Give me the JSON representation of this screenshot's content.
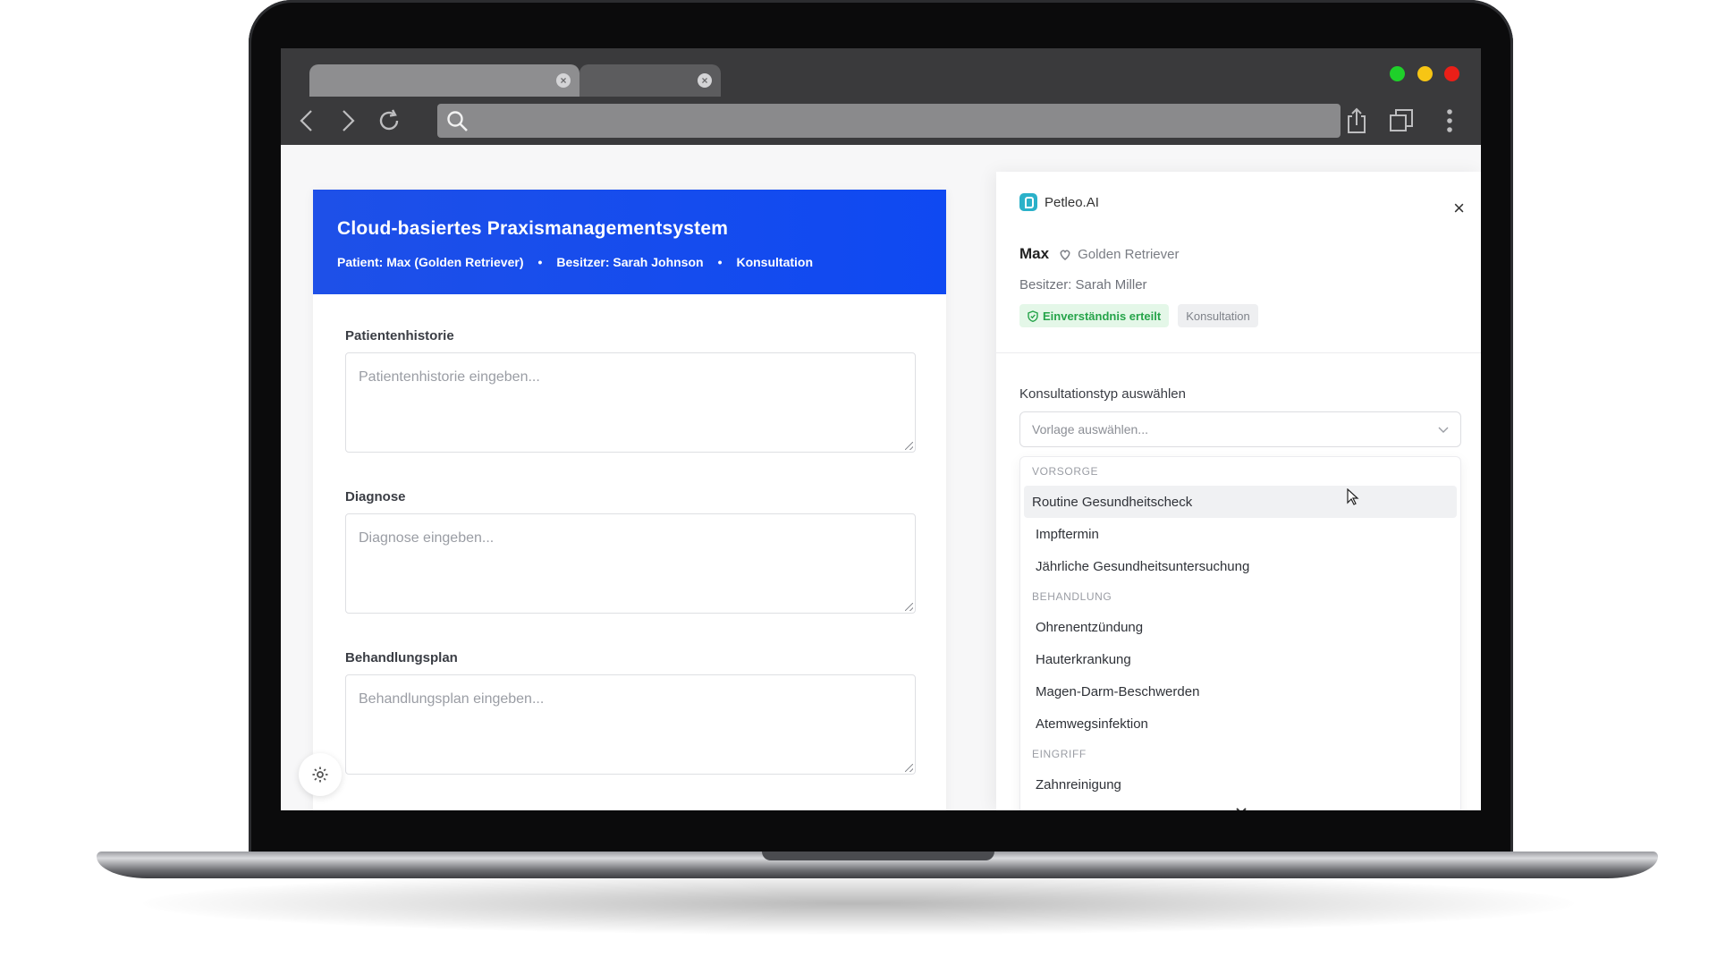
{
  "browser": {
    "tabs": [
      {
        "close_icon": "×"
      },
      {
        "close_icon": "×"
      }
    ],
    "address_bar": {
      "value": ""
    }
  },
  "form": {
    "title": "Cloud-basiertes Praxismanagementsystem",
    "meta": {
      "patient": "Patient: Max (Golden Retriever)",
      "owner": "Besitzer: Sarah Johnson",
      "type": "Konsultation",
      "separator": "•"
    },
    "fields": [
      {
        "label": "Patientenhistorie",
        "placeholder": "Patientenhistorie eingeben..."
      },
      {
        "label": "Diagnose",
        "placeholder": "Diagnose eingeben..."
      },
      {
        "label": "Behandlungsplan",
        "placeholder": "Behandlungsplan eingeben..."
      }
    ]
  },
  "panel": {
    "brand": "Petleo.AI",
    "close": "×",
    "pet_name": "Max",
    "breed": "Golden Retriever",
    "owner": "Besitzer: Sarah Miller",
    "badges": {
      "consent": "Einverständnis erteilt",
      "type": "Konsultation"
    },
    "select_label": "Konsultationstyp auswählen",
    "select_placeholder": "Vorlage auswählen...",
    "dropdown": {
      "groups": [
        {
          "name": "VORSORGE",
          "items": [
            "Routine Gesundheitscheck",
            "Impftermin",
            "Jährliche Gesundheitsuntersuchung"
          ]
        },
        {
          "name": "BEHANDLUNG",
          "items": [
            "Ohrenentzündung",
            "Hauterkrankung",
            "Magen-Darm-Beschwerden",
            "Atemwegsinfektion"
          ]
        },
        {
          "name": "EINGRIFF",
          "items": [
            "Zahnreinigung"
          ]
        }
      ],
      "highlighted_item": "Routine Gesundheitscheck"
    }
  },
  "colors": {
    "header_blue": "#1e50e8",
    "consent_green": "#26a44a",
    "brand_teal": "#2bb1c9"
  }
}
